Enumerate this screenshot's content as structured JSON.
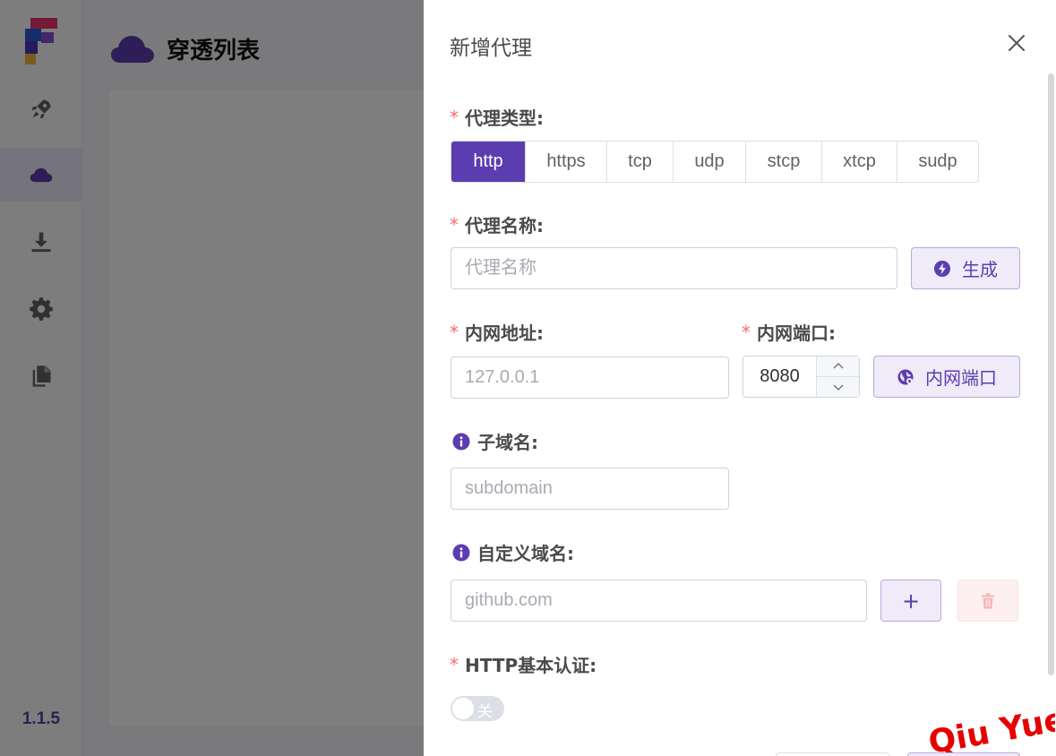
{
  "sidebar": {
    "version": "1.1.5",
    "items": [
      {
        "icon": "rocket-icon",
        "active": false
      },
      {
        "icon": "cloud-icon",
        "active": true
      },
      {
        "icon": "download-icon",
        "active": false
      },
      {
        "icon": "gear-icon",
        "active": false
      },
      {
        "icon": "document-icon",
        "active": false
      }
    ]
  },
  "main": {
    "title": "穿透列表",
    "title_icon": "cloud-icon"
  },
  "drawer": {
    "title": "新增代理",
    "proxy_type": {
      "label": "代理类型:",
      "options": [
        "http",
        "https",
        "tcp",
        "udp",
        "stcp",
        "xtcp",
        "sudp"
      ],
      "selected": "http"
    },
    "proxy_name": {
      "label": "代理名称:",
      "value": "",
      "placeholder": "代理名称",
      "generate_label": "生成"
    },
    "local_ip": {
      "label": "内网地址:",
      "value": "",
      "placeholder": "127.0.0.1"
    },
    "local_port": {
      "label": "内网端口:",
      "value": "8080",
      "button_label": "内网端口"
    },
    "subdomain": {
      "label": "子域名:",
      "value": "",
      "placeholder": "subdomain"
    },
    "custom_domain": {
      "label": "自定义域名:",
      "value": "",
      "placeholder": "github.com",
      "add_label": "+"
    },
    "http_auth": {
      "label": "HTTP基本认证:",
      "switch_text": "关",
      "enabled": false
    }
  },
  "watermark": "Qiu Yue",
  "colors": {
    "primary": "#5b3db0",
    "required": "#f56c6c",
    "soft_bg": "#efebf8",
    "danger_bg": "#fef0f0",
    "overlay": "rgba(0,0,0,0.5)"
  }
}
